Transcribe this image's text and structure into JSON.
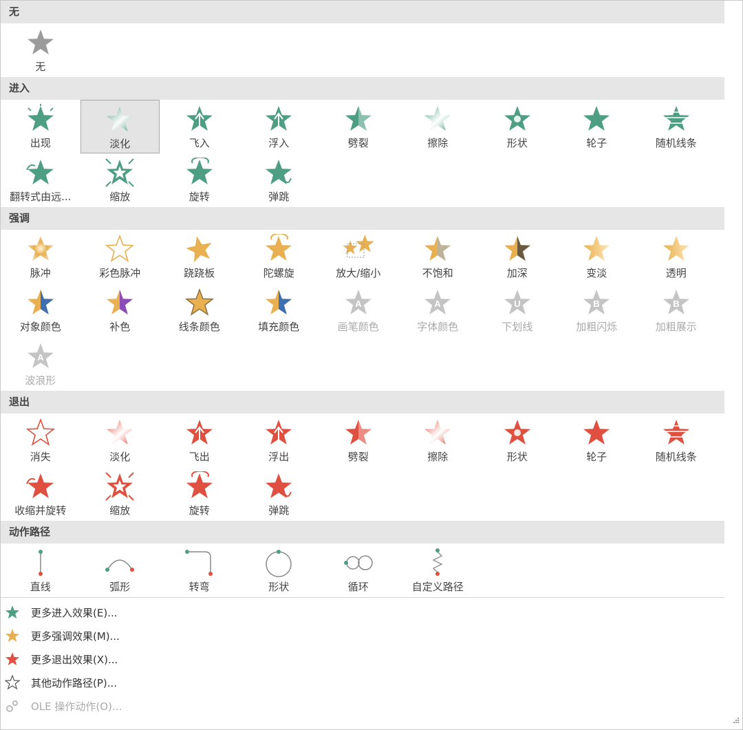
{
  "colors": {
    "none": "#9b9b9b",
    "entrance": "#4e9e84",
    "emphasis": "#e8b050",
    "exit": "#e05040",
    "disabled": "#c4c4c4",
    "path": "#777777"
  },
  "sections": {
    "none": {
      "title": "无",
      "items": [
        {
          "label": "无",
          "icon": "star-icon"
        }
      ]
    },
    "entrance": {
      "title": "进入",
      "items": [
        {
          "label": "出现",
          "icon": "appear-icon"
        },
        {
          "label": "淡化",
          "icon": "fade-icon",
          "selected": true
        },
        {
          "label": "飞入",
          "icon": "fly-in-icon"
        },
        {
          "label": "浮入",
          "icon": "float-in-icon"
        },
        {
          "label": "劈裂",
          "icon": "split-icon"
        },
        {
          "label": "擦除",
          "icon": "wipe-icon"
        },
        {
          "label": "形状",
          "icon": "shape-icon"
        },
        {
          "label": "轮子",
          "icon": "wheel-icon"
        },
        {
          "label": "随机线条",
          "icon": "random-bars-icon"
        },
        {
          "label": "翻转式由远...",
          "icon": "grow-turn-icon"
        },
        {
          "label": "缩放",
          "icon": "zoom-icon"
        },
        {
          "label": "旋转",
          "icon": "swivel-icon"
        },
        {
          "label": "弹跳",
          "icon": "bounce-icon"
        }
      ]
    },
    "emphasis": {
      "title": "强调",
      "items": [
        {
          "label": "脉冲",
          "icon": "pulse-icon"
        },
        {
          "label": "彩色脉冲",
          "icon": "color-pulse-icon"
        },
        {
          "label": "跷跷板",
          "icon": "teeter-icon"
        },
        {
          "label": "陀螺旋",
          "icon": "spin-icon"
        },
        {
          "label": "放大/缩小",
          "icon": "grow-shrink-icon"
        },
        {
          "label": "不饱和",
          "icon": "desaturate-icon"
        },
        {
          "label": "加深",
          "icon": "darken-icon"
        },
        {
          "label": "变淡",
          "icon": "lighten-icon"
        },
        {
          "label": "透明",
          "icon": "transparency-icon"
        },
        {
          "label": "对象颜色",
          "icon": "object-color-icon"
        },
        {
          "label": "补色",
          "icon": "complementary-color-icon"
        },
        {
          "label": "线条颜色",
          "icon": "line-color-icon"
        },
        {
          "label": "填充颜色",
          "icon": "fill-color-icon"
        },
        {
          "label": "画笔颜色",
          "icon": "brush-color-icon",
          "disabled": true,
          "letter": "A"
        },
        {
          "label": "字体颜色",
          "icon": "font-color-icon",
          "disabled": true,
          "letter": "A"
        },
        {
          "label": "下划线",
          "icon": "underline-icon",
          "disabled": true,
          "letter": "U"
        },
        {
          "label": "加粗闪烁",
          "icon": "bold-flash-icon",
          "disabled": true,
          "letter": "B"
        },
        {
          "label": "加粗展示",
          "icon": "bold-reveal-icon",
          "disabled": true,
          "letter": "B"
        },
        {
          "label": "波浪形",
          "icon": "wave-icon",
          "disabled": true,
          "letter": "A"
        }
      ]
    },
    "exit": {
      "title": "退出",
      "items": [
        {
          "label": "消失",
          "icon": "disappear-icon"
        },
        {
          "label": "淡化",
          "icon": "fade-icon"
        },
        {
          "label": "飞出",
          "icon": "fly-out-icon"
        },
        {
          "label": "浮出",
          "icon": "float-out-icon"
        },
        {
          "label": "劈裂",
          "icon": "split-icon"
        },
        {
          "label": "擦除",
          "icon": "wipe-icon"
        },
        {
          "label": "形状",
          "icon": "shape-icon"
        },
        {
          "label": "轮子",
          "icon": "wheel-icon"
        },
        {
          "label": "随机线条",
          "icon": "random-bars-icon"
        },
        {
          "label": "收缩并旋转",
          "icon": "shrink-turn-icon"
        },
        {
          "label": "缩放",
          "icon": "zoom-icon"
        },
        {
          "label": "旋转",
          "icon": "swivel-icon"
        },
        {
          "label": "弹跳",
          "icon": "bounce-icon"
        }
      ]
    },
    "motion": {
      "title": "动作路径",
      "items": [
        {
          "label": "直线",
          "icon": "line-path-icon"
        },
        {
          "label": "弧形",
          "icon": "arc-path-icon"
        },
        {
          "label": "转弯",
          "icon": "turn-path-icon"
        },
        {
          "label": "形状",
          "icon": "circle-path-icon"
        },
        {
          "label": "循环",
          "icon": "loop-path-icon"
        },
        {
          "label": "自定义路径",
          "icon": "custom-path-icon"
        }
      ]
    }
  },
  "more": [
    {
      "label": "更多进入效果(E)...",
      "icon": "green-star-icon",
      "kind": "entrance"
    },
    {
      "label": "更多强调效果(M)...",
      "icon": "gold-star-icon",
      "kind": "emphasis"
    },
    {
      "label": "更多退出效果(X)...",
      "icon": "red-star-icon",
      "kind": "exit"
    },
    {
      "label": "其他动作路径(P)...",
      "icon": "outline-star-icon",
      "kind": "outline"
    },
    {
      "label": "OLE 操作动作(O)...",
      "icon": "gears-icon",
      "kind": "gears",
      "disabled": true
    }
  ]
}
